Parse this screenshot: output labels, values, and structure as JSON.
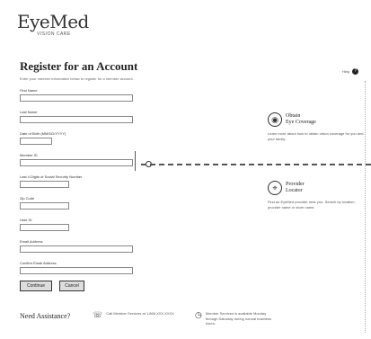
{
  "brand": {
    "name": "EyeMed",
    "tagline": "VISION CARE"
  },
  "page": {
    "title": "Register for an Account",
    "intro": "Enter your member information below to register for a member account.",
    "help_label": "Help"
  },
  "form": {
    "fields": [
      {
        "label": "First Name",
        "value": ""
      },
      {
        "label": "Last Name",
        "value": ""
      },
      {
        "label": "Date of Birth (MM/DD/YYYY)",
        "value": ""
      },
      {
        "label": "Member ID",
        "value": ""
      },
      {
        "label": "Last 4 Digits of Social Security Number",
        "value": ""
      },
      {
        "label": "Zip Code",
        "value": ""
      },
      {
        "label": "User ID",
        "value": ""
      },
      {
        "label": "Email Address",
        "value": ""
      },
      {
        "label": "Confirm Email Address",
        "value": ""
      }
    ],
    "submit_label": "Continue",
    "cancel_label": "Cancel"
  },
  "aside": {
    "cards": [
      {
        "icon": "eye-icon",
        "title_line1": "Obtain",
        "title_line2": "Eye Coverage",
        "text": "Learn more about how to obtain vision coverage for you and your family."
      },
      {
        "icon": "location-pin-icon",
        "title_line1": "Provider",
        "title_line2": "Locator",
        "text": "Find an EyeMed provider near you. Search by location, provider name or store name."
      }
    ]
  },
  "footer": {
    "need_help": "Need Assistance?",
    "items": [
      {
        "icon": "phone-icon",
        "text": "Call Member Services at 1.866.XXX.XXXX"
      },
      {
        "icon": "clock-icon",
        "text": "Member Services is available Monday through Saturday during normal business hours."
      }
    ]
  }
}
